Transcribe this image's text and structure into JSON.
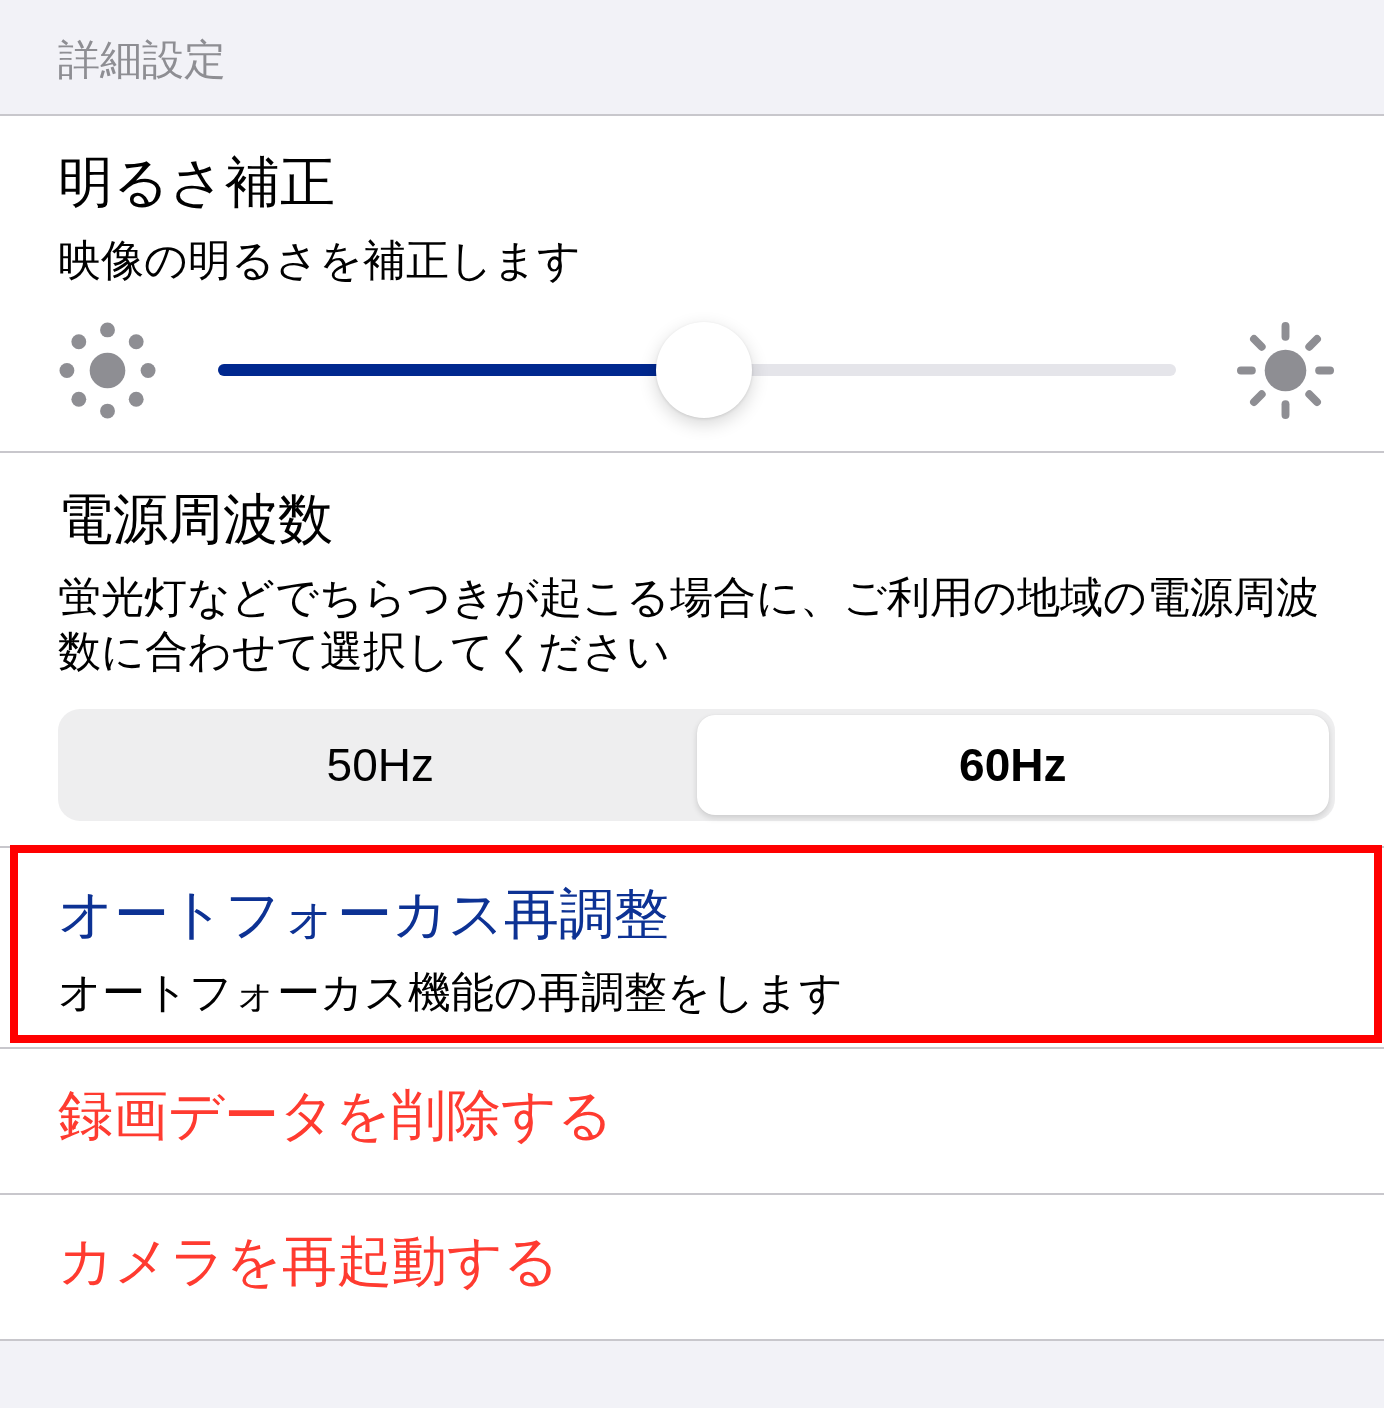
{
  "section_header": "詳細設定",
  "brightness": {
    "title": "明るさ補正",
    "description": "映像の明るさを補正します",
    "slider": {
      "level": 0.507
    }
  },
  "power_frequency": {
    "title": "電源周波数",
    "description": "蛍光灯などでちらつきが起こる場合に、ご利用の地域の電源周波数に合わせて選択してください",
    "options": [
      {
        "label": "50Hz",
        "selected": false
      },
      {
        "label": "60Hz",
        "selected": true
      }
    ]
  },
  "actions": [
    {
      "kind": "link",
      "title": "オートフォーカス再調整",
      "description": "オートフォーカス機能の再調整をします",
      "highlighted": true
    },
    {
      "kind": "destructive",
      "title": "録画データを削除する",
      "highlighted": false
    },
    {
      "kind": "destructive",
      "title": "カメラを再起動する",
      "highlighted": false
    }
  ]
}
